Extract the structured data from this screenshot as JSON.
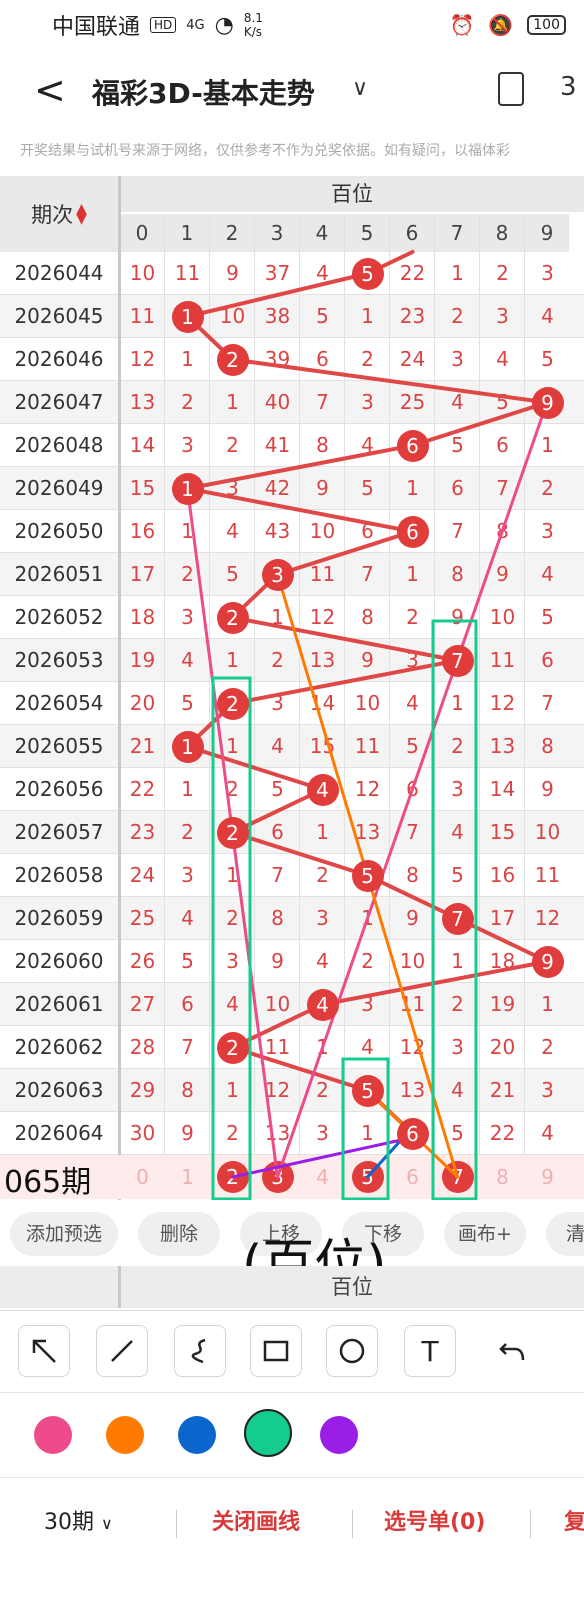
{
  "status": {
    "carrier": "中国联通",
    "hd": "HD",
    "signal": "4G",
    "speed_value": "8.1",
    "speed_unit": "K/s",
    "battery": "100"
  },
  "header": {
    "title": "福彩3D-基本走势",
    "back_icon": "chevron-left-icon",
    "menu_icon": "chevron-down-icon"
  },
  "disclaimer": "开奖结果与试机号来源于网络，仅供参考不作为兑奖依据。如有疑问，以福体彩",
  "table": {
    "issue_header": "期次",
    "section_title": "百位",
    "digits": [
      "0",
      "1",
      "2",
      "3",
      "4",
      "5",
      "6",
      "7",
      "8",
      "9"
    ],
    "rows": [
      {
        "issue": "2026044",
        "cells": [
          "10",
          "11",
          "9",
          "37",
          "4",
          "5",
          "22",
          "1",
          "2",
          "3"
        ],
        "hit": 5
      },
      {
        "issue": "2026045",
        "cells": [
          "11",
          "1",
          "10",
          "38",
          "5",
          "1",
          "23",
          "2",
          "3",
          "4"
        ],
        "hit": 1
      },
      {
        "issue": "2026046",
        "cells": [
          "12",
          "1",
          "2",
          "39",
          "6",
          "2",
          "24",
          "3",
          "4",
          "5"
        ],
        "hit": 2
      },
      {
        "issue": "2026047",
        "cells": [
          "13",
          "2",
          "1",
          "40",
          "7",
          "3",
          "25",
          "4",
          "5",
          "9"
        ],
        "hit": 9
      },
      {
        "issue": "2026048",
        "cells": [
          "14",
          "3",
          "2",
          "41",
          "8",
          "4",
          "6",
          "5",
          "6",
          "1"
        ],
        "hit": 6
      },
      {
        "issue": "2026049",
        "cells": [
          "15",
          "1",
          "3",
          "42",
          "9",
          "5",
          "1",
          "6",
          "7",
          "2"
        ],
        "hit": 1
      },
      {
        "issue": "2026050",
        "cells": [
          "16",
          "1",
          "4",
          "43",
          "10",
          "6",
          "6",
          "7",
          "8",
          "3"
        ],
        "hit": 6
      },
      {
        "issue": "2026051",
        "cells": [
          "17",
          "2",
          "5",
          "3",
          "11",
          "7",
          "1",
          "8",
          "9",
          "4"
        ],
        "hit": 3
      },
      {
        "issue": "2026052",
        "cells": [
          "18",
          "3",
          "2",
          "1",
          "12",
          "8",
          "2",
          "9",
          "10",
          "5"
        ],
        "hit": 2
      },
      {
        "issue": "2026053",
        "cells": [
          "19",
          "4",
          "1",
          "2",
          "13",
          "9",
          "3",
          "7",
          "11",
          "6"
        ],
        "hit": 7
      },
      {
        "issue": "2026054",
        "cells": [
          "20",
          "5",
          "2",
          "3",
          "14",
          "10",
          "4",
          "1",
          "12",
          "7"
        ],
        "hit": 2
      },
      {
        "issue": "2026055",
        "cells": [
          "21",
          "1",
          "1",
          "4",
          "15",
          "11",
          "5",
          "2",
          "13",
          "8"
        ],
        "hit": 1
      },
      {
        "issue": "2026056",
        "cells": [
          "22",
          "1",
          "2",
          "5",
          "4",
          "12",
          "6",
          "3",
          "14",
          "9"
        ],
        "hit": 4
      },
      {
        "issue": "2026057",
        "cells": [
          "23",
          "2",
          "2",
          "6",
          "1",
          "13",
          "7",
          "4",
          "15",
          "10"
        ],
        "hit": 2
      },
      {
        "issue": "2026058",
        "cells": [
          "24",
          "3",
          "1",
          "7",
          "2",
          "5",
          "8",
          "5",
          "16",
          "11"
        ],
        "hit": 5
      },
      {
        "issue": "2026059",
        "cells": [
          "25",
          "4",
          "2",
          "8",
          "3",
          "1",
          "9",
          "7",
          "17",
          "12"
        ],
        "hit": 7
      },
      {
        "issue": "2026060",
        "cells": [
          "26",
          "5",
          "3",
          "9",
          "4",
          "2",
          "10",
          "1",
          "18",
          "9"
        ],
        "hit": 9
      },
      {
        "issue": "2026061",
        "cells": [
          "27",
          "6",
          "4",
          "10",
          "4",
          "3",
          "11",
          "2",
          "19",
          "1"
        ],
        "hit": 4
      },
      {
        "issue": "2026062",
        "cells": [
          "28",
          "7",
          "2",
          "11",
          "1",
          "4",
          "12",
          "3",
          "20",
          "2"
        ],
        "hit": 2
      },
      {
        "issue": "2026063",
        "cells": [
          "29",
          "8",
          "1",
          "12",
          "2",
          "5",
          "13",
          "4",
          "21",
          "3"
        ],
        "hit": 5
      },
      {
        "issue": "2026064",
        "cells": [
          "30",
          "9",
          "2",
          "13",
          "3",
          "1",
          "6",
          "5",
          "22",
          "4"
        ],
        "hit": 6
      }
    ],
    "partial_row": {
      "issue": "065期",
      "cells": [
        "0",
        "1",
        "2",
        "3",
        "4",
        "5",
        "6",
        "7",
        "8",
        "9"
      ],
      "balls": [
        2,
        3,
        5,
        7
      ]
    }
  },
  "actions": [
    "添加预选",
    "删除",
    "上移",
    "下移",
    "画布+",
    "清"
  ],
  "overlay_text": "(百位)",
  "lower_strip_title": "百位",
  "tools": [
    "arrow-tool-icon",
    "line-tool-icon",
    "curve-tool-icon",
    "rectangle-tool-icon",
    "circle-tool-icon",
    "text-tool-icon",
    "undo-icon"
  ],
  "tool_text_glyph": "T",
  "palette": [
    "#ee4b8a",
    "#ff7a00",
    "#0a66cc",
    "#13cc8e",
    "#9a1ee6"
  ],
  "selected_color": "#13cc8e",
  "bottom": {
    "periods": "30期",
    "close_lines": "关闭画线",
    "selection": "选号单(0)",
    "more": "复"
  }
}
